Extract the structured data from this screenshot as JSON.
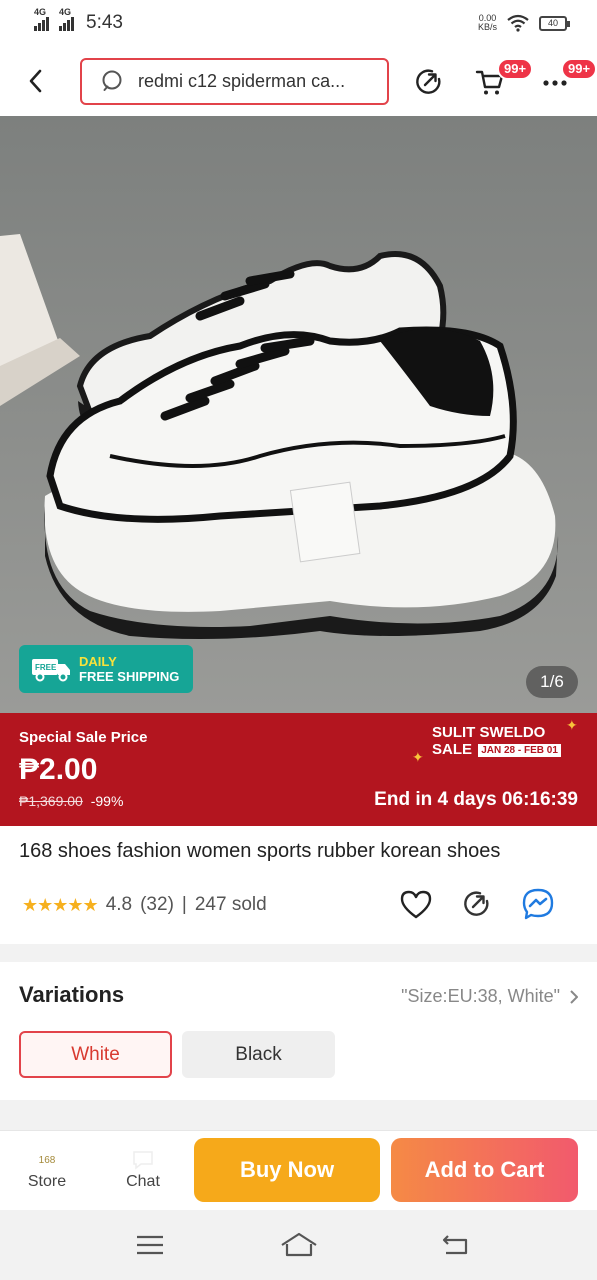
{
  "status_bar": {
    "network1": "4G",
    "network2": "4G",
    "time": "5:43",
    "speed_value": "0.00",
    "speed_unit": "KB/s",
    "battery": "40"
  },
  "header": {
    "search_text": "redmi c12 spiderman ca...",
    "cart_badge": "99+",
    "more_badge": "99+"
  },
  "gallery": {
    "shipping_free": "FREE",
    "shipping_line1": "DAILY",
    "shipping_line2": "FREE SHIPPING",
    "page_indicator": "1/6"
  },
  "sale": {
    "label": "Special Sale Price",
    "price": "₱2.00",
    "original_price": "₱1,369.00",
    "discount": "-99%",
    "campaign_line1": "SULIT SWELDO",
    "campaign_line2": "SALE",
    "campaign_dates": "JAN 28 - FEB 01",
    "countdown": "End in 4 days 06:16:39"
  },
  "product": {
    "title": "168 shoes fashion women sports rubber korean shoes",
    "rating": "4.8",
    "reviews": "(32)",
    "separator": "|",
    "sold": "247 sold",
    "stars": "★★★★★"
  },
  "variations": {
    "title": "Variations",
    "selected": "\"Size:EU:38, White\"",
    "options": [
      "White",
      "Black"
    ]
  },
  "bottom_bar": {
    "store_logo": "168",
    "store_label": "Store",
    "chat_label": "Chat",
    "buy_now": "Buy Now",
    "add_to_cart": "Add to Cart"
  },
  "colors": {
    "accent_red": "#e2434a",
    "sale_bg": "#b3151f",
    "buy_now": "#f6a91a",
    "add_to_cart": "#f25a6d",
    "free_shipping": "#16a596"
  }
}
